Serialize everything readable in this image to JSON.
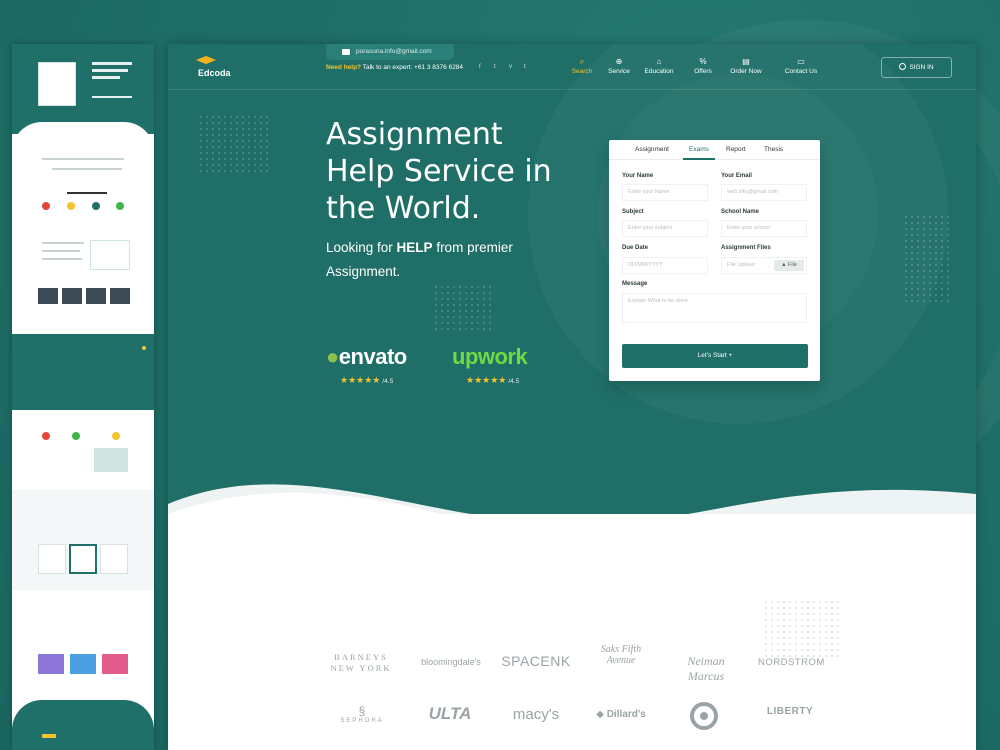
{
  "colors": {
    "primary": "#1f7069",
    "accent": "#f4c430",
    "white": "#ffffff"
  },
  "header": {
    "email": "porasuna.info@gmail.com",
    "help_label": "Need help?",
    "help_text": "Talk to an expert: +61 3 8376 6284",
    "social": [
      "f",
      "t",
      "v",
      "t"
    ],
    "logo_name": "Edcoda",
    "nav": [
      {
        "label": "Search",
        "icon": "search-icon"
      },
      {
        "label": "Service",
        "icon": "globe-icon"
      },
      {
        "label": "Education",
        "icon": "graduation-cap-icon"
      },
      {
        "label": "Offers",
        "icon": "percent-icon"
      },
      {
        "label": "Order Now",
        "icon": "document-icon"
      },
      {
        "label": "Contact Us",
        "icon": "chat-icon"
      }
    ],
    "signin": "SIGN IN"
  },
  "hero": {
    "title_line1": "Assignment",
    "title_line2": "Help Service in",
    "title_line3": "the World.",
    "sub_pre": "Looking for ",
    "sub_bold": "HELP",
    "sub_post": " from premier Assignment."
  },
  "ratings": [
    {
      "brand": "envato",
      "stars": "★★★★★",
      "rating": "/4.5"
    },
    {
      "brand": "upwork",
      "stars": "★★★★★",
      "rating": "/4.5"
    }
  ],
  "form": {
    "tabs": [
      "Assignment",
      "Exams",
      "Report",
      "Thesis"
    ],
    "active_tab": "Exams",
    "name_label": "Your Name",
    "name_placeholder": "Enter your Name",
    "email_label": "Your Email",
    "email_placeholder": "web.info@gmail.com",
    "subject_label": "Subject",
    "subject_placeholder": "Enter your subject",
    "school_label": "School Name",
    "school_placeholder": "Enter your school",
    "date_label": "Due Date",
    "date_placeholder": "DD/MM/YYYY",
    "files_label": "Assignment Files",
    "files_placeholder": "File Upload",
    "file_button": "File",
    "message_label": "Message",
    "message_placeholder": "Explain What to be done",
    "submit": "Let's Start +"
  },
  "brands": [
    "BARNEYS NEW YORK",
    "bloomingdale's",
    "SPACENK",
    "Saks Fifth Avenue",
    "Neiman Marcus",
    "NORDSTROM",
    "SEPHORA",
    "ULTA",
    "macy's",
    "Dillard's",
    "target",
    "LIBERTY"
  ]
}
